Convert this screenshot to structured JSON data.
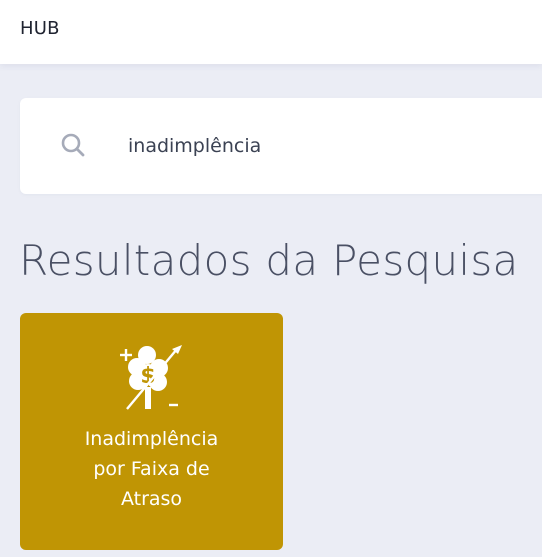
{
  "header": {
    "brand": "HUB"
  },
  "search": {
    "value": "inadimplência",
    "icon": "search-icon"
  },
  "results": {
    "title": "Resultados da Pesquisa",
    "cards": [
      {
        "title_lines": [
          "Inadimplência",
          "por Faixa de",
          "Atraso"
        ],
        "icon": "money-tree-icon",
        "color": "#c09504"
      }
    ]
  },
  "colors": {
    "background": "#ebedf5",
    "card": "#c09504",
    "text_dark": "#1f2330",
    "title": "#4a5064"
  }
}
